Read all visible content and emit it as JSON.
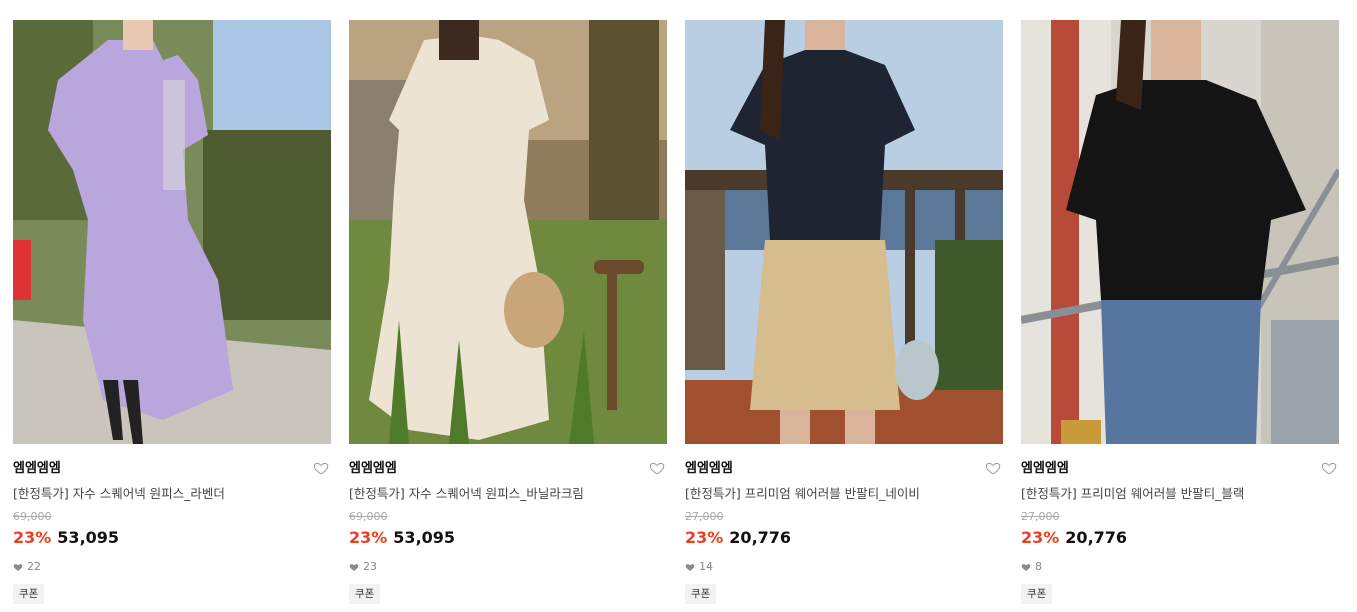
{
  "products": [
    {
      "brand": "엠엠엠엠",
      "name": "[한정특가] 자수 스퀘어넥 원피스_라벤더",
      "original_price": "69,000",
      "discount": "23%",
      "price": "53,095",
      "likes": "22",
      "badge": "쿠폰",
      "main_color": "#b8a6dc"
    },
    {
      "brand": "엠엠엠엠",
      "name": "[한정특가] 자수 스퀘어넥 원피스_바닐라크림",
      "original_price": "69,000",
      "discount": "23%",
      "price": "53,095",
      "likes": "23",
      "badge": "쿠폰",
      "main_color": "#ece3d2"
    },
    {
      "brand": "엠엠엠엠",
      "name": "[한정특가] 프리미엄 웨어러블 반팔티_네이비",
      "original_price": "27,000",
      "discount": "23%",
      "price": "20,776",
      "likes": "14",
      "badge": "쿠폰",
      "main_color": "#1f2433"
    },
    {
      "brand": "엠엠엠엠",
      "name": "[한정특가] 프리미엄 웨어러블 반팔티_블랙",
      "original_price": "27,000",
      "discount": "23%",
      "price": "20,776",
      "likes": "8",
      "badge": "쿠폰",
      "main_color": "#141414"
    }
  ],
  "accent_color": "#f13c20"
}
